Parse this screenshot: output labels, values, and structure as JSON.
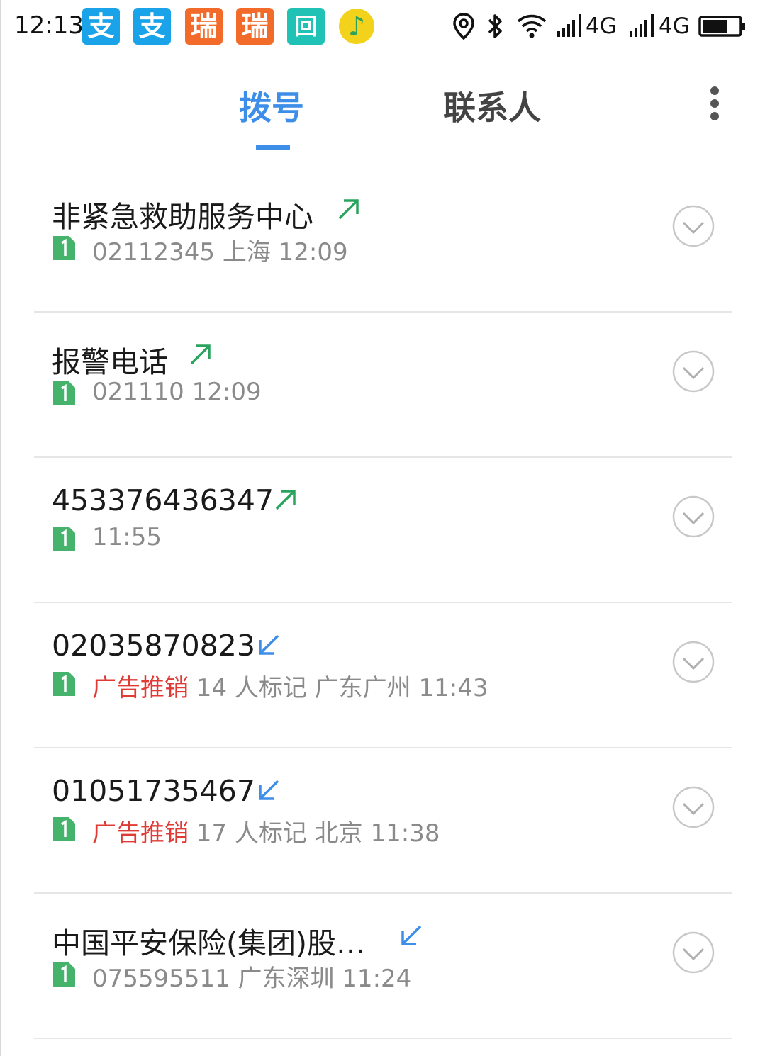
{
  "status_bar": {
    "time": "12:13",
    "apps": [
      {
        "icon": "alipay-icon",
        "glyph": "支",
        "color": "#1aa3e8"
      },
      {
        "icon": "alipay-icon",
        "glyph": "支",
        "color": "#1aa3e8"
      },
      {
        "icon": "ruixing-icon",
        "glyph": "瑞",
        "color": "#f26b2a"
      },
      {
        "icon": "ruixing-icon",
        "glyph": "瑞",
        "color": "#f26b2a"
      },
      {
        "icon": "scan-icon",
        "glyph": "回",
        "color": "#1fc2b4"
      },
      {
        "icon": "qq-music-icon",
        "glyph": "♪",
        "color": "#f2d21a"
      }
    ],
    "network_1": "4G",
    "network_2": "4G",
    "battery_level": 0.7
  },
  "tabs": {
    "dial": "拨号",
    "contacts": "联系人",
    "active": "dial",
    "accent": "#3d8ee8"
  },
  "calls": [
    {
      "name": "非紧急救助服务中心",
      "direction": "outgoing",
      "tag": "",
      "meta": "02112345 上海 12:09"
    },
    {
      "name": "报警电话",
      "direction": "outgoing",
      "tag": "",
      "meta": "021110 12:09"
    },
    {
      "name": "453376436347",
      "direction": "outgoing",
      "tag": "",
      "meta": "11:55"
    },
    {
      "name": "02035870823",
      "direction": "incoming",
      "tag": "广告推销",
      "meta": " 14 人标记 广东广州 11:43"
    },
    {
      "name": "01051735467",
      "direction": "incoming",
      "tag": "广告推销",
      "meta": " 17 人标记 北京 11:38"
    },
    {
      "name": "中国平安保险(集团)股…",
      "direction": "incoming",
      "tag": "",
      "meta": "075595511 广东深圳 11:24"
    }
  ],
  "colors": {
    "outgoing": "#2aa35e",
    "incoming": "#3d8ee8",
    "sim": "#45b36b",
    "tag": "#e03a35"
  }
}
